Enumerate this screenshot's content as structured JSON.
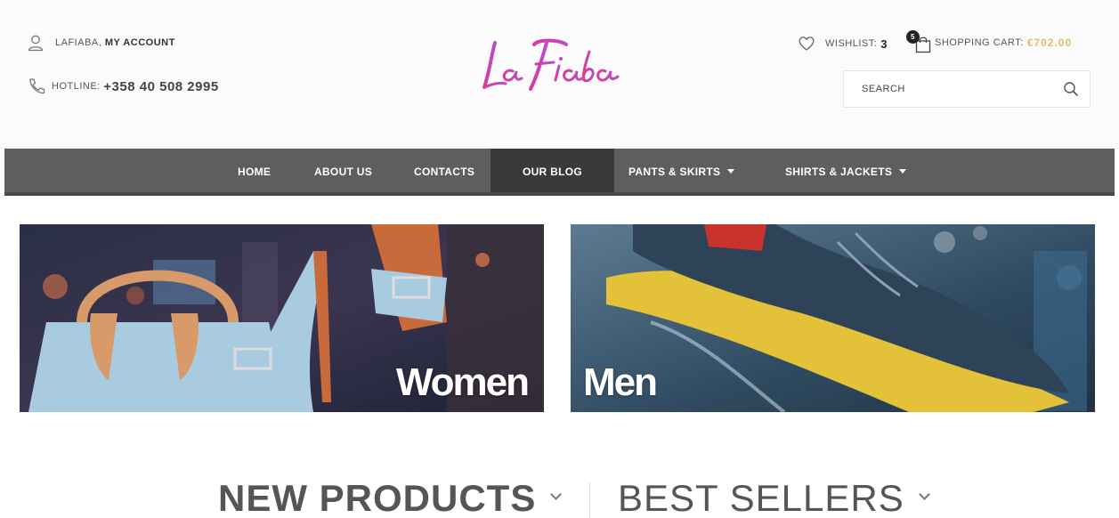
{
  "header": {
    "account_name": "LAFIABA,",
    "account_link": "MY ACCOUNT",
    "hotline_label": "HOTLINE:",
    "hotline_number": "+358 40 508 2995",
    "logo_text": "La Fiaba",
    "wishlist_label": "WISHLIST:",
    "wishlist_count": "3",
    "cart_badge": "5",
    "cart_label": "SHOPPING CART:",
    "cart_total": "€702.00",
    "search_placeholder": "SEARCH",
    "icons": {
      "account": "user-icon",
      "hotline": "phone-icon",
      "wishlist": "heart-icon",
      "cart": "shopping-bag-icon",
      "search": "search-icon"
    }
  },
  "nav": {
    "items": [
      {
        "label": "HOME"
      },
      {
        "label": "ABOUT US"
      },
      {
        "label": "CONTACTS"
      },
      {
        "label": "OUR BLOG",
        "active": true
      },
      {
        "label": "PANTS & SKIRTS",
        "dropdown": true
      },
      {
        "label": "SHIRTS & JACKETS",
        "dropdown": true
      }
    ]
  },
  "banners": [
    {
      "label": "Women"
    },
    {
      "label": "Men"
    }
  ],
  "tabs": [
    {
      "label": "NEW PRODUCTS",
      "active": true
    },
    {
      "label": "BEST SELLERS",
      "active": false
    }
  ],
  "colors": {
    "accent": "#e8b76a",
    "logo": "#d93a9a",
    "nav_bg": "#5e5e5e",
    "nav_active": "#3a3a3a"
  }
}
